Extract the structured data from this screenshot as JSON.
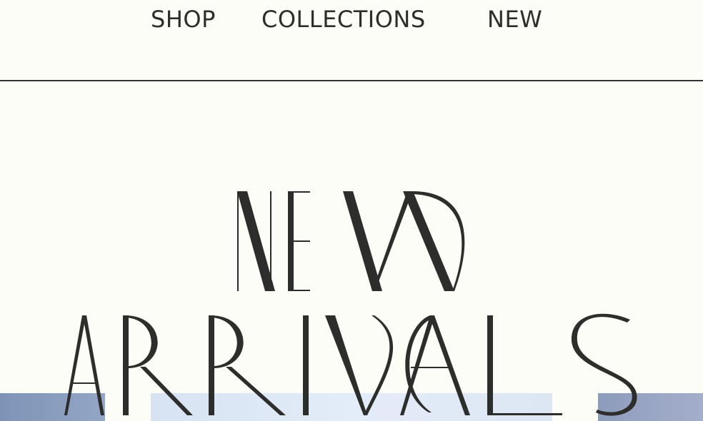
{
  "nav": {
    "items": [
      {
        "label": "SHOP"
      },
      {
        "label": "COLLECTIONS"
      },
      {
        "label": "NEW"
      }
    ]
  },
  "hero": {
    "headline_line1": "NEW",
    "headline_line2": "ARRIVALS"
  },
  "colors": {
    "background": "#fdfdf8",
    "ink": "#2d2d2b"
  }
}
